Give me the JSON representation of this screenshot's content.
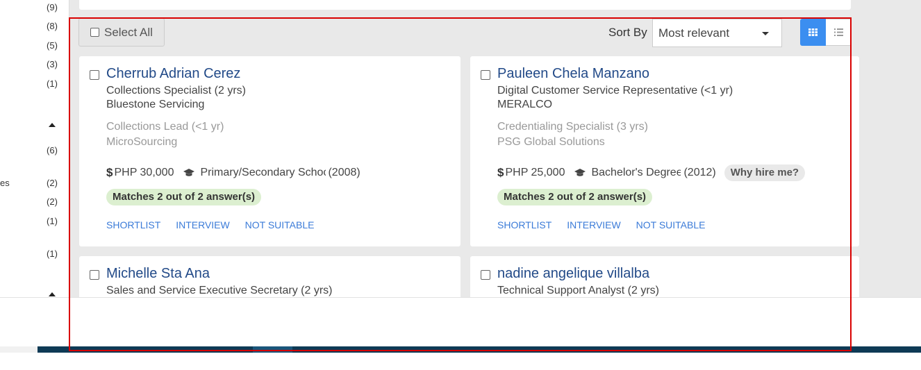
{
  "sidebar": {
    "counts": [
      "(9)",
      "(8)",
      "(5)",
      "(3)",
      "(1)",
      "(6)",
      "(2)",
      "(2)",
      "(1)",
      "(1)"
    ],
    "partial_label": "es"
  },
  "toolbar": {
    "select_all_label": "Select All",
    "sort_by_label": "Sort By",
    "sort_value": "Most relevant",
    "view_mode": "grid"
  },
  "candidates": [
    {
      "name": "Cherrub Adrian Cerez",
      "current_role": "Collections Specialist",
      "current_duration": "(2 yrs)",
      "current_company": "Bluestone Servicing",
      "prev_role": "Collections Lead",
      "prev_duration": "(<1 yr)",
      "prev_company": "MicroSourcing",
      "salary": "PHP 30,000",
      "education": "Primary/Secondary School",
      "education_year": "(2008)",
      "why_hire": "",
      "match": "Matches 2 out of 2 answer(s)",
      "actions": [
        "SHORTLIST",
        "INTERVIEW",
        "NOT SUITABLE"
      ]
    },
    {
      "name": "Pauleen Chela Manzano",
      "current_role": "Digital Customer Service Representative",
      "current_duration": "(<1 yr)",
      "current_company": "MERALCO",
      "prev_role": "Credentialing Specialist",
      "prev_duration": "(3 yrs)",
      "prev_company": "PSG Global Solutions",
      "salary": "PHP 25,000",
      "education": "Bachelor's Degree",
      "education_year": "(2012)",
      "why_hire": "Why hire me?",
      "match": "Matches 2 out of 2 answer(s)",
      "actions": [
        "SHORTLIST",
        "INTERVIEW",
        "NOT SUITABLE"
      ]
    },
    {
      "name": "Michelle Sta Ana",
      "current_role": "Sales and Service Executive Secretary",
      "current_duration": "(2 yrs)"
    },
    {
      "name": "nadine angelique villalba",
      "current_role": "Technical Support Analyst",
      "current_duration": "(2 yrs)"
    }
  ],
  "colors": {
    "accent_blue": "#3b8ef0",
    "name_blue": "#224a88",
    "action_blue": "#3b7bd8",
    "match_green": "#dcefd0",
    "highlight_red": "#d90000",
    "footer_navy": "#0e3a55"
  }
}
